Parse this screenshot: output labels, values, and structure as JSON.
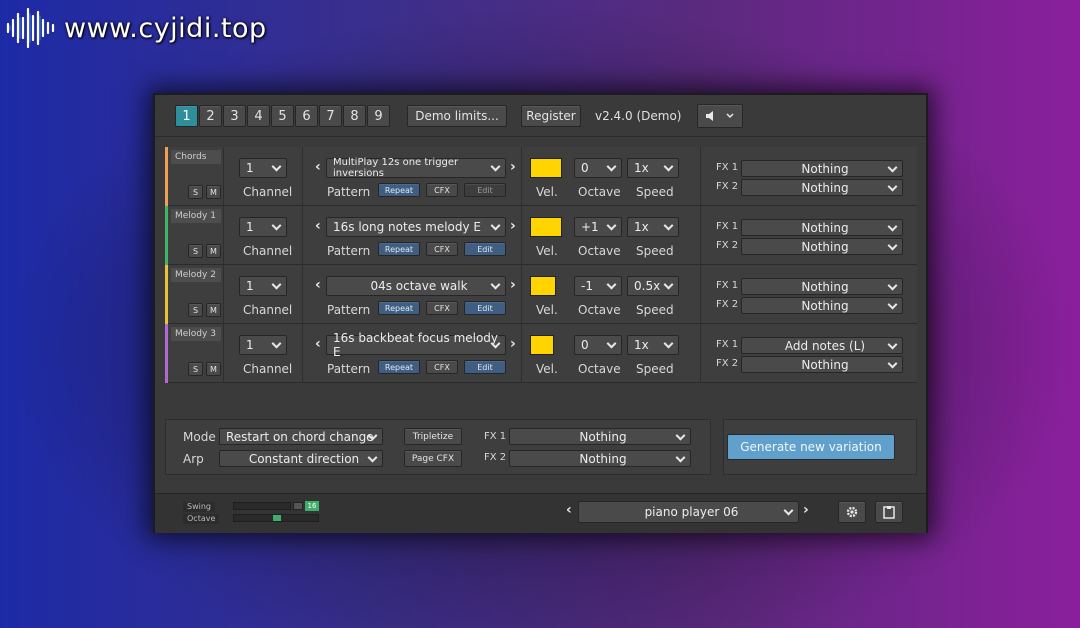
{
  "watermark": {
    "text": "www.cyjidi.top"
  },
  "toolbar": {
    "tabs": [
      "1",
      "2",
      "3",
      "4",
      "5",
      "6",
      "7",
      "8",
      "9"
    ],
    "active_tab": "1",
    "demo_limits_label": "Demo limits...",
    "register_label": "Register",
    "version": "v2.4.0 (Demo)"
  },
  "labels": {
    "channel": "Channel",
    "pattern": "Pattern",
    "vel": "Vel.",
    "octave": "Octave",
    "speed": "Speed",
    "fx1": "FX 1",
    "fx2": "FX 2",
    "solo": "S",
    "mute": "M",
    "repeat": "Repeat",
    "cfx": "CFX",
    "edit": "Edit"
  },
  "tracks": [
    {
      "name": "Chords",
      "channel": "1",
      "pattern": "MultiPlay 12s one trigger inversions",
      "octave": "0",
      "speed": "1x",
      "fx1": "Nothing",
      "fx2": "Nothing",
      "color": "#f0a050"
    },
    {
      "name": "Melody 1",
      "channel": "1",
      "pattern": "16s long notes melody E",
      "octave": "+1",
      "speed": "1x",
      "fx1": "Nothing",
      "fx2": "Nothing",
      "color": "#3fb56a"
    },
    {
      "name": "Melody 2",
      "channel": "1",
      "pattern": "04s octave walk",
      "octave": "-1",
      "speed": "0.5x",
      "fx1": "Nothing",
      "fx2": "Nothing",
      "color": "#e8c23a"
    },
    {
      "name": "Melody 3",
      "channel": "1",
      "pattern": "16s backbeat focus melody E",
      "octave": "0",
      "speed": "1x",
      "fx1": "Add notes (L)",
      "fx2": "Nothing",
      "color": "#b06ad0"
    }
  ],
  "global": {
    "mode_label": "Mode",
    "mode_value": "Restart on chord change",
    "arp_label": "Arp",
    "arp_value": "Constant direction",
    "tripletize_label": "Tripletize",
    "page_cfx_label": "Page CFX",
    "fx1_value": "Nothing",
    "fx2_value": "Nothing",
    "generate_label": "Generate new variation"
  },
  "footer": {
    "swing_label": "Swing",
    "octave_label": "Octave",
    "preset": "piano player 06",
    "swing_value": "16"
  },
  "colors": {
    "accent": "#2e8f9a",
    "velocity": "#ffd400",
    "generate": "#5fa0cc"
  }
}
